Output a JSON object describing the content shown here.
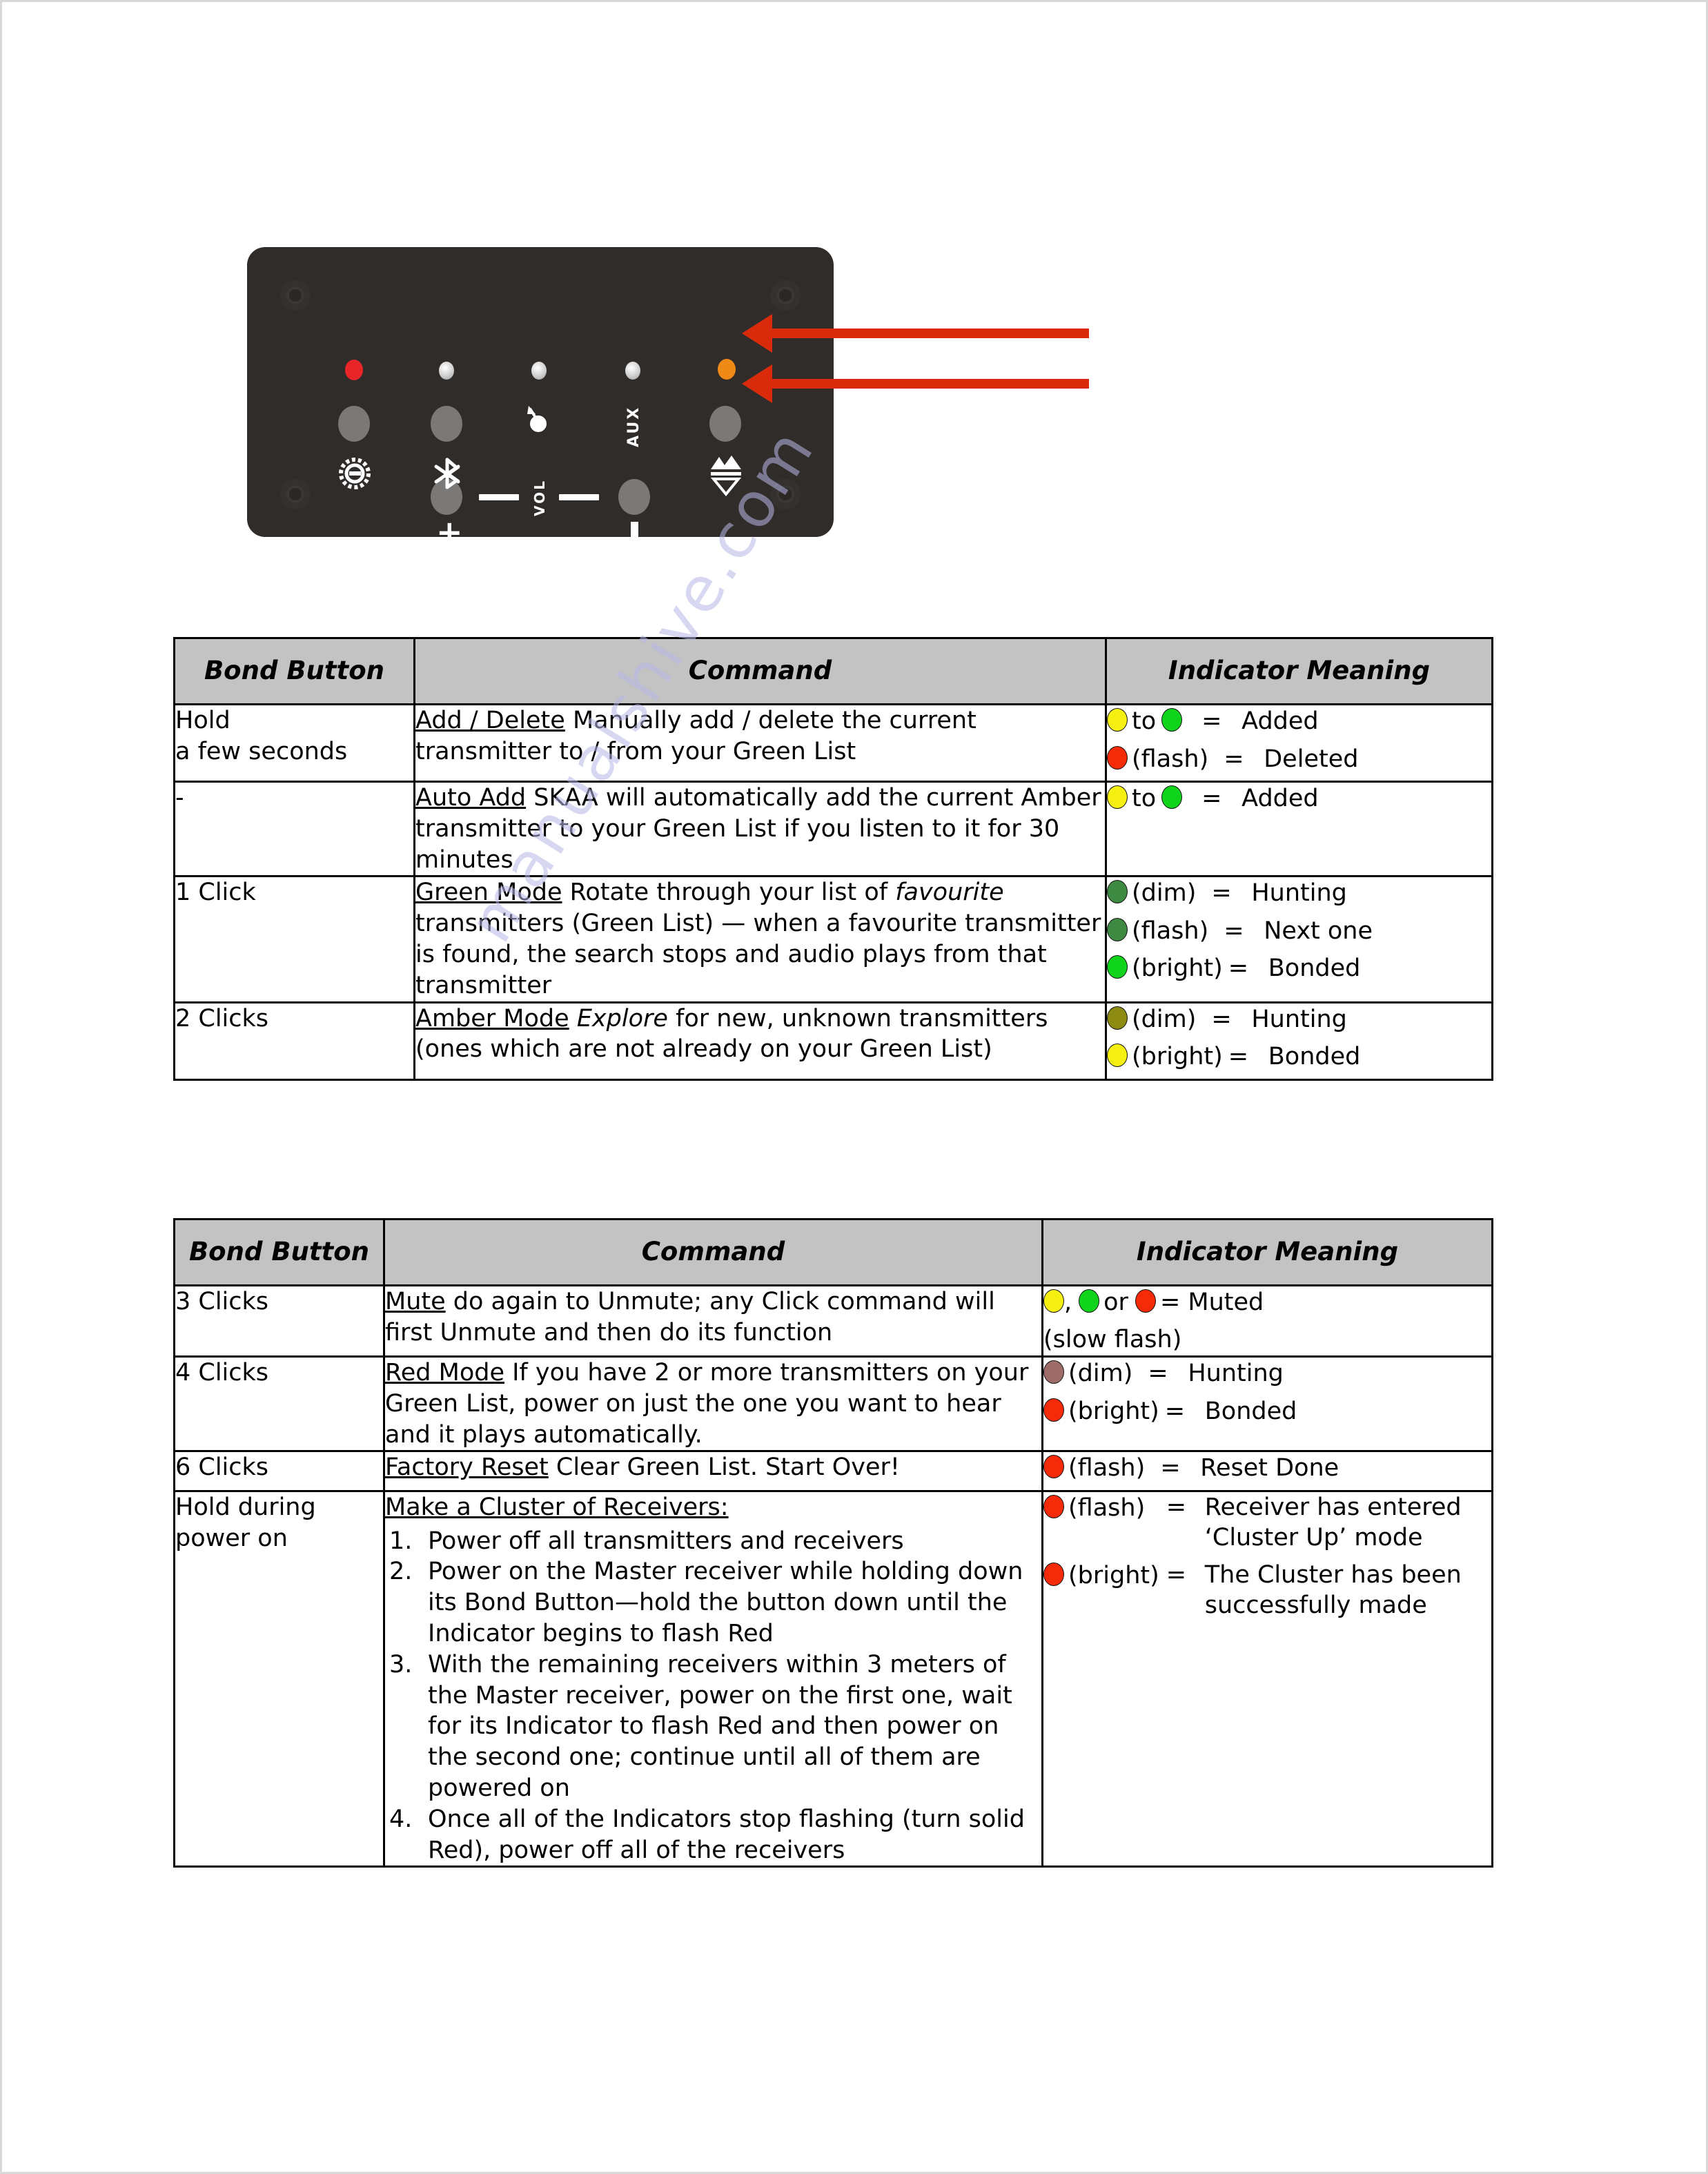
{
  "watermark": {
    "text": "manualshive.com"
  },
  "device": {
    "name": "skaa-receiver-front-panel",
    "labels": {
      "aux": "AUX",
      "vol": "VOL",
      "plus": "+",
      "minus": "|"
    },
    "icons": {
      "power": "power-icon",
      "bluetooth": "bluetooth-icon",
      "balloon": "balloon-icon",
      "aux": "aux-icon",
      "bond": "bond-speaker-icon"
    },
    "leds": [
      "red",
      "white",
      "white",
      "white",
      "orange"
    ],
    "annotations": [
      {
        "label": "indicator-arrow",
        "target": "orange-indicator-led"
      },
      {
        "label": "bond-button-arrow",
        "target": "bond-button"
      }
    ]
  },
  "table1": {
    "headers": [
      "Bond Button",
      "Command",
      "Indicator Meaning"
    ],
    "rows": [
      {
        "button": "Hold\na few seconds",
        "command_title": "Add / Delete",
        "command_text": " Manually add / delete the current transmitter to / from your Green List",
        "indicators": [
          {
            "dots": [
              "yellow",
              "green"
            ],
            "connector": "to",
            "state": "",
            "eq": "=",
            "meaning": "Added"
          },
          {
            "dots": [
              "red"
            ],
            "connector": "",
            "state": "(flash)",
            "eq": "=",
            "meaning": "Deleted"
          }
        ]
      },
      {
        "button": "-",
        "command_title": "Auto Add",
        "command_text": "  SKAA will automatically add the current Amber transmitter to your Green List if you listen to it for 30 minutes",
        "indicators": [
          {
            "dots": [
              "yellow",
              "green"
            ],
            "connector": "to",
            "state": "",
            "eq": "=",
            "meaning": "Added"
          }
        ]
      },
      {
        "button": "1 Click",
        "command_title": "Green Mode",
        "command_text": "  Rotate through your list of ",
        "command_italic": "favourite",
        "command_text2": " transmitters (Green List) — when a favourite transmitter is found, the search stops and audio plays from that transmitter",
        "indicators": [
          {
            "dots": [
              "greendim"
            ],
            "connector": "",
            "state": "(dim)",
            "eq": "=",
            "meaning": "Hunting"
          },
          {
            "dots": [
              "greendim"
            ],
            "connector": "",
            "state": "(flash)",
            "eq": "=",
            "meaning": "Next one"
          },
          {
            "dots": [
              "green"
            ],
            "connector": "",
            "state": "(bright)",
            "eq": "=",
            "meaning": "Bonded"
          }
        ]
      },
      {
        "button": "2 Clicks",
        "command_title": "Amber Mode",
        "command_italic": "Explore",
        "command_text2": " for new, unknown transmitters (ones which are not already on your Green List)",
        "indicators": [
          {
            "dots": [
              "amberdim"
            ],
            "connector": "",
            "state": "(dim)",
            "eq": "=",
            "meaning": "Hunting"
          },
          {
            "dots": [
              "yellow"
            ],
            "connector": "",
            "state": "(bright)",
            "eq": "=",
            "meaning": "Bonded"
          }
        ]
      }
    ]
  },
  "table2": {
    "headers": [
      "Bond Button",
      "Command",
      "Indicator Meaning"
    ],
    "rows": [
      {
        "button": "3 Clicks",
        "command_title": "Mute",
        "command_text": "  do again to Unmute; any Click command will first Unmute and then do its function",
        "mute_line1_dots": [
          "yellow",
          "green",
          "red"
        ],
        "mute_line1_sep1": ",",
        "mute_line1_sep2": "or",
        "mute_line1_eq": "= Muted",
        "mute_line2": "(slow flash)"
      },
      {
        "button": "4 Clicks",
        "command_title": "Red Mode",
        "command_text": "  If you have 2 or more transmitters on your Green List, power on just the one you want to hear and it plays automatically.",
        "indicators": [
          {
            "dots": [
              "reddim"
            ],
            "state": "(dim)",
            "eq": "=",
            "meaning": "Hunting"
          },
          {
            "dots": [
              "red"
            ],
            "state": "(bright)",
            "eq": "=",
            "meaning": "Bonded"
          }
        ]
      },
      {
        "button": "6 Clicks",
        "command_title": "Factory Reset",
        "command_text": "  Clear Green List.  Start Over!",
        "indicators": [
          {
            "dots": [
              "red"
            ],
            "state": "(flash)",
            "eq": "=",
            "meaning": "Reset Done"
          }
        ]
      },
      {
        "button": "Hold during\npower on",
        "command_title": "Make a Cluster of Receivers:",
        "steps": [
          "Power off all transmitters and receivers",
          "Power on the Master receiver while holding down its Bond Button—hold the button down until the Indicator begins to flash Red",
          "With the remaining receivers within 3 meters of the Master receiver, power on the first one, wait for its Indicator to flash Red and then power on the second one; continue until all of them are powered on",
          "Once all of the Indicators stop flashing (turn solid Red), power off all of the receivers"
        ],
        "indicators": [
          {
            "dots": [
              "red"
            ],
            "state": "(flash)",
            "eq": "=",
            "meaning": "Receiver has entered ‘Cluster Up’ mode"
          },
          {
            "dots": [
              "red"
            ],
            "state": "(bright)",
            "eq": "=",
            "meaning": "The Cluster has been successfully made"
          }
        ]
      }
    ]
  },
  "colors": {
    "header_bg": "#c3c3c3",
    "arrow_red": "#d92b0c",
    "device_body": "#2f2c2a",
    "led_red": "#e8262a",
    "led_orange": "#f08a16",
    "watermark": "#b9b8e8"
  }
}
